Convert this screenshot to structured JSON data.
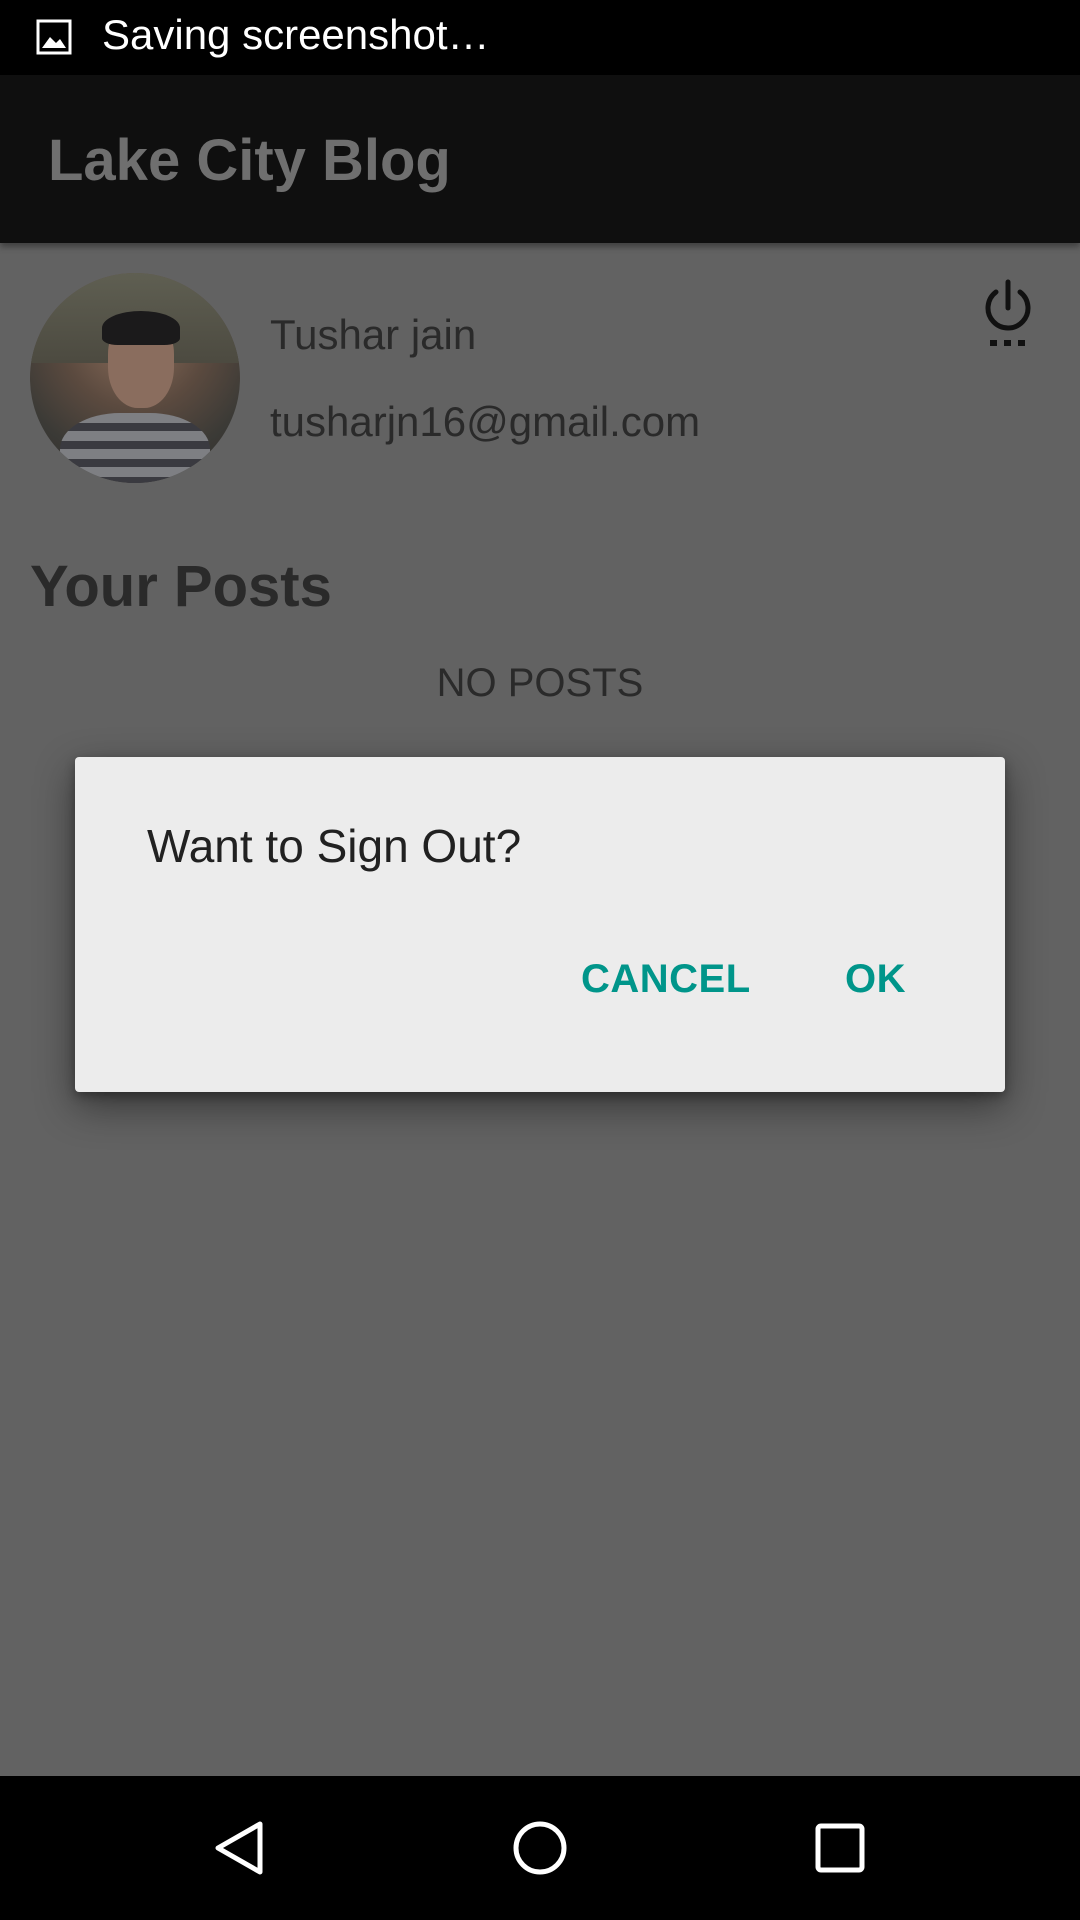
{
  "status_bar": {
    "notification_icon": "image-icon",
    "text": "Saving screenshot…"
  },
  "app_bar": {
    "title": "Lake City Blog"
  },
  "profile": {
    "name": "Tushar jain",
    "email": "tusharjn16@gmail.com",
    "avatar_icon": "avatar-photo",
    "action_icon": "power-settings-icon"
  },
  "posts": {
    "section_title": "Your Posts",
    "empty_text": "NO POSTS"
  },
  "dialog": {
    "message": "Want to Sign Out?",
    "cancel_label": "CANCEL",
    "ok_label": "OK",
    "accent_color": "#00958a"
  },
  "nav_bar": {
    "back_icon": "back-triangle-icon",
    "home_icon": "home-circle-icon",
    "recents_icon": "recents-square-icon"
  }
}
